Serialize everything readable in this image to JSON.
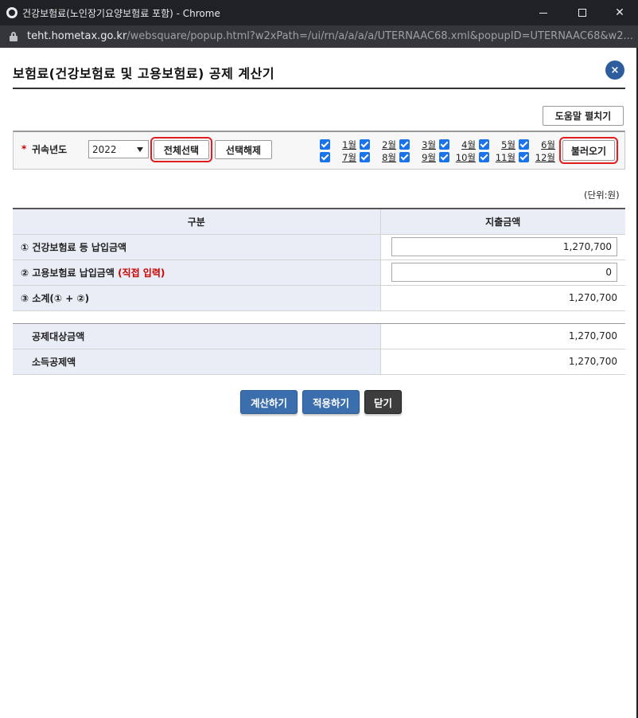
{
  "window": {
    "title": "건강보험료(노인장기요양보험료 포함) - Chrome",
    "url_host": "teht.hometax.go.kr",
    "url_path": "/websquare/popup.html?w2xPath=/ui/rn/a/a/a/a/UTERNAAC68.xml&popupID=UTERNAAC68&w2..."
  },
  "header": {
    "title": "보험료(건강보험료 및 고용보험료) 공제 계산기",
    "close_icon": "×"
  },
  "toolbar": {
    "help_label": "도움말 펼치기"
  },
  "filter": {
    "required_mark": "*",
    "year_label": "귀속년도",
    "year_value": "2022",
    "select_all_label": "전체선택",
    "deselect_label": "선택해제",
    "load_label": "불러오기",
    "months": [
      {
        "label": "1월",
        "checked": true
      },
      {
        "label": "2월",
        "checked": true
      },
      {
        "label": "3월",
        "checked": true
      },
      {
        "label": "4월",
        "checked": true
      },
      {
        "label": "5월",
        "checked": true
      },
      {
        "label": "6월",
        "checked": true
      },
      {
        "label": "7월",
        "checked": true
      },
      {
        "label": "8월",
        "checked": true
      },
      {
        "label": "9월",
        "checked": true
      },
      {
        "label": "10월",
        "checked": true
      },
      {
        "label": "11월",
        "checked": true
      },
      {
        "label": "12월",
        "checked": true
      }
    ]
  },
  "unit_label": "(단위:원)",
  "table": {
    "col_category": "구분",
    "col_amount": "지출금액",
    "row1_label": "① 건강보험료 등 납입금액",
    "row1_value": "1,270,700",
    "row2_label": "② 고용보험료 납입금액 ",
    "row2_note": "(직접 입력)",
    "row2_value": "0",
    "row3_label": "③ 소계(① + ②)",
    "row3_value": "1,270,700",
    "row4_label": "공제대상금액",
    "row4_value": "1,270,700",
    "row5_label": "소득공제액",
    "row5_value": "1,270,700"
  },
  "actions": {
    "calculate_label": "계산하기",
    "apply_label": "적용하기",
    "close_label": "닫기"
  },
  "colors": {
    "accent_blue": "#3b6eac",
    "highlight_red": "#e02020",
    "header_bg": "#e9edf5"
  }
}
